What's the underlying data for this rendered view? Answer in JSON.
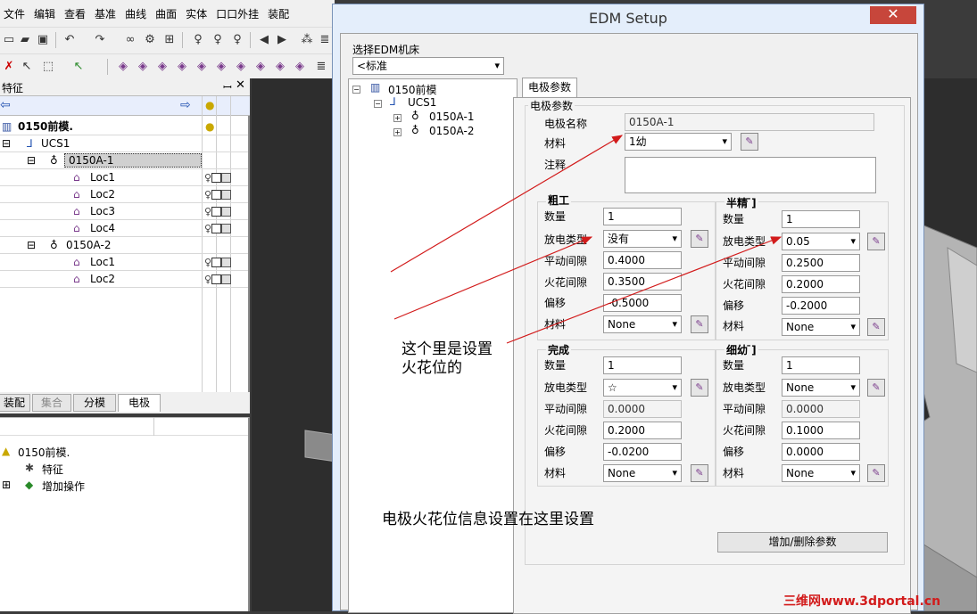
{
  "menu": [
    "文件",
    "编辑",
    "查看",
    "基准",
    "曲线",
    "曲面",
    "实体",
    "口口外挂",
    "装配"
  ],
  "feature_panel": {
    "title": "特征",
    "rows": [
      {
        "label": "0150前模.",
        "level": 0,
        "bold": true
      },
      {
        "label": "UCS1",
        "level": 1
      },
      {
        "label": "0150A-1",
        "level": 2,
        "selected": true
      },
      {
        "label": "Loc1",
        "level": 3
      },
      {
        "label": "Loc2",
        "level": 3
      },
      {
        "label": "Loc3",
        "level": 3
      },
      {
        "label": "Loc4",
        "level": 3
      },
      {
        "label": "0150A-2",
        "level": 2
      },
      {
        "label": "Loc1",
        "level": 3
      },
      {
        "label": "Loc2",
        "level": 3
      }
    ]
  },
  "bottom_tabs": [
    "装配",
    "集合",
    "分模",
    "电极"
  ],
  "ops_tree": [
    "0150前模.",
    "特征",
    "增加操作"
  ],
  "dialog": {
    "title": "EDM Setup",
    "close": "✕",
    "machine_label": "选择EDM机床",
    "machine_value": "<标准",
    "tree": [
      "0150前模",
      "UCS1",
      "0150A-1",
      "0150A-2"
    ],
    "tab": "电极参数",
    "group_title": "电极参数",
    "name_label": "电极名称",
    "name_value": "0150A-1",
    "material_label": "材料",
    "material_value": "1幼",
    "note_label": "注释",
    "sections": {
      "rough": {
        "title": "粗工",
        "qty": "1",
        "type": "没有",
        "orbit": "0.4000",
        "spark": "0.3500",
        "offset": "-0.5000",
        "mat": "None"
      },
      "semi": {
        "title": "半精 ̄]",
        "qty": "1",
        "type": "0.05",
        "orbit": "0.2500",
        "spark": "0.2000",
        "offset": "-0.2000",
        "mat": "None"
      },
      "finish": {
        "title": "完成",
        "qty": "1",
        "type": "☆",
        "orbit": "0.0000",
        "spark": "0.2000",
        "offset": "-0.0200",
        "mat": "None"
      },
      "fine": {
        "title": "细幼 ̄]",
        "qty": "1",
        "type": "None",
        "orbit": "0.0000",
        "spark": "0.1000",
        "offset": "0.0000",
        "mat": "None"
      }
    },
    "field_labels": {
      "qty": "数量",
      "type": "放电类型",
      "orbit": "平动间隙",
      "spark": "火花间隙",
      "offset": "偏移",
      "mat": "材料"
    },
    "add_delete_button": "增加/删除参数"
  },
  "annotations": {
    "note1_line1": "这个里是设置",
    "note1_line2": "火花位的",
    "note2": "电极火花位信息设置在这里设置"
  },
  "watermark": "三维网www.3dportal.cn"
}
